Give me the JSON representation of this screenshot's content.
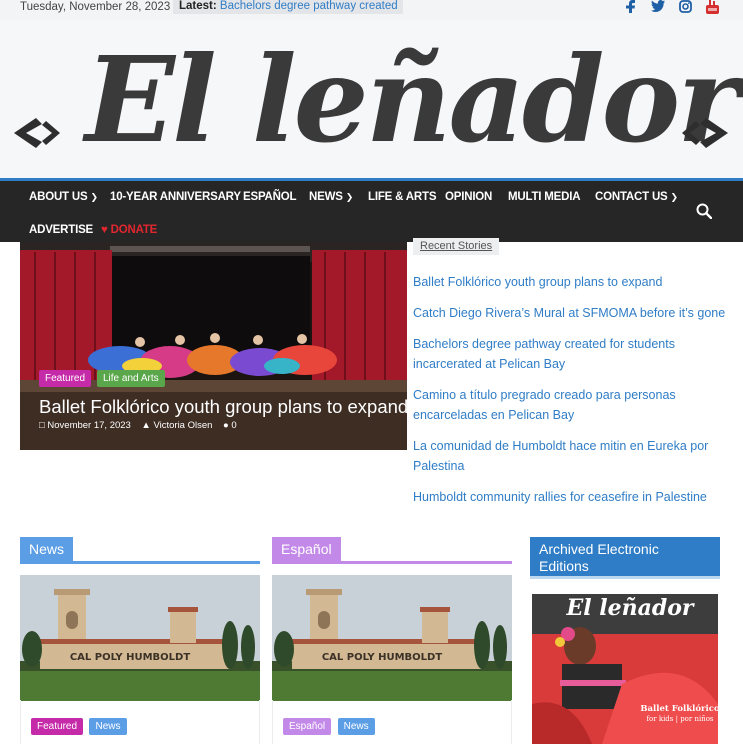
{
  "topbar": {
    "date": "Tuesday, November 28, 2023",
    "latest_label": "Latest:",
    "latest_text": "Bachelors degree pathway created",
    "social_icons": [
      "facebook-icon",
      "twitter-icon",
      "instagram-icon",
      "youtube-icon"
    ]
  },
  "header": {
    "logo_text": "El leñador"
  },
  "nav": {
    "items": [
      {
        "label": "About Us"
      },
      {
        "label": "10-Year Anniversary"
      },
      {
        "label": "Español"
      },
      {
        "label": "News"
      },
      {
        "label": "Life & Arts"
      },
      {
        "label": "Opinion"
      },
      {
        "label": "Multi Media"
      },
      {
        "label": "Contact Us"
      },
      {
        "label": "Advertise"
      },
      {
        "label": "Donate"
      }
    ],
    "donate_heart": "♥"
  },
  "hero": {
    "badges": [
      "Featured",
      "Life and Arts"
    ],
    "title": "Ballet Folklórico youth group plans to expand",
    "date": "November 17, 2023",
    "author": "Victoria Olsen",
    "comments": "0"
  },
  "recent": {
    "tab_label": "Recent Stories",
    "items": [
      "Ballet Folklórico youth group plans to expand",
      "Catch Diego Rivera’s Mural at SFMOMA before it’s gone",
      "Bachelors degree pathway created for students incarcerated at Pelican Bay",
      "Camino a título pregrado creado para personas encarceladas en Pelican Bay",
      "La comunidad de Humboldt hace mitin en Eureka por Palestina",
      "Humboldt community rallies for ceasefire in Palestine"
    ]
  },
  "sections": {
    "news": {
      "label": "News",
      "tags": [
        "Featured",
        "News"
      ],
      "sign_text": "CAL POLY HUMBOLDT"
    },
    "espanol": {
      "label": "Español",
      "tags": [
        "Español",
        "News"
      ],
      "sign_text": "CAL POLY HUMBOLDT"
    },
    "archive": {
      "label": "Archived Electronic Editions",
      "cover_logo": "El leñador",
      "cover_caption_1": "Ballet Folklórico",
      "cover_caption_2": "for kids | por niños"
    }
  },
  "colors": {
    "accent_blue": "#2f7dc6",
    "nav_bg": "#262626",
    "featured": "#c52aa8",
    "life_arts": "#5aa64a",
    "espanol": "#c389e8",
    "news_tag": "#5c9ee6",
    "donate": "#e2262f"
  }
}
